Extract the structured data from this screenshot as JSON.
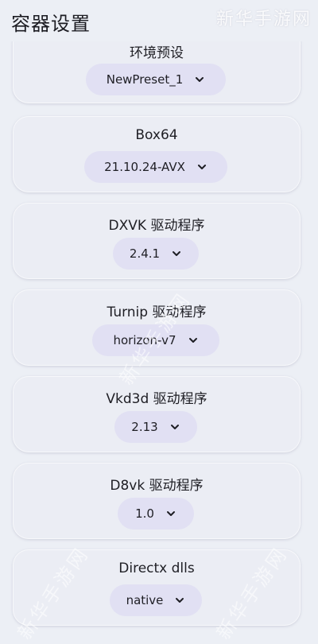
{
  "header": {
    "title": "容器设置",
    "watermark": "新华手游网"
  },
  "settings": [
    {
      "label": "环境预设",
      "value": "NewPreset_1"
    },
    {
      "label": "Box64",
      "value": "21.10.24-AVX"
    },
    {
      "label": "DXVK 驱动程序",
      "value": "2.4.1"
    },
    {
      "label": "Turnip 驱动程序",
      "value": "horizon-v7"
    },
    {
      "label": "Vkd3d 驱动程序",
      "value": "2.13"
    },
    {
      "label": "D8vk 驱动程序",
      "value": "1.0"
    },
    {
      "label": "Directx dlls",
      "value": "native"
    }
  ],
  "icons": {
    "dropdown": "chevron-down-icon"
  },
  "colors": {
    "background": "#eceff5",
    "card": "#ebedf4",
    "select_pill": "#e1e0f3",
    "text": "#1e1e24"
  }
}
